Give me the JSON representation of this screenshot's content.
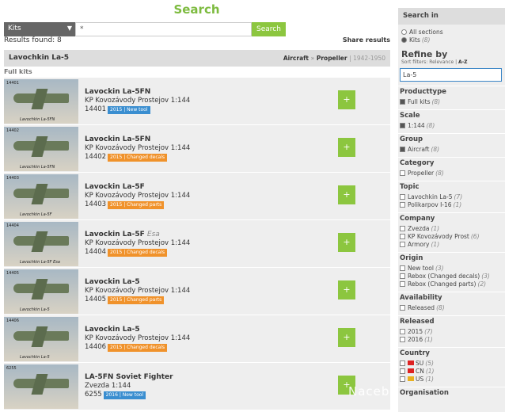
{
  "title": "Search",
  "search": {
    "category": "Kits",
    "query": "*",
    "button": "Search"
  },
  "results_found": "Results found: 8",
  "share": "Share results",
  "header": {
    "name": "Lavochkin La-5",
    "crumb1": "Aircraft",
    "sep": "»",
    "crumb2": "Propeller",
    "years": "| 1942-1950"
  },
  "section_label": "Full kits",
  "items": [
    {
      "name": "Lavockin La-5FN",
      "suffix": "",
      "maker": "KP Kovozávody Prostejov 1:144",
      "code": "14401",
      "badge": "2015 | New tool",
      "badge_color": "#3a8ed0",
      "caption": "Lavochkin La-5FN"
    },
    {
      "name": "Lavockin La-5FN",
      "suffix": "",
      "maker": "KP Kovozávody Prostejov 1:144",
      "code": "14402",
      "badge": "2015 | Changed decals",
      "badge_color": "#f0922b",
      "caption": "Lavochkin La-5FN"
    },
    {
      "name": "Lavockin La-5F",
      "suffix": "",
      "maker": "KP Kovozávody Prostejov 1:144",
      "code": "14403",
      "badge": "2015 | Changed parts",
      "badge_color": "#f0922b",
      "caption": "Lavochkin La-5F"
    },
    {
      "name": "Lavockin La-5F",
      "suffix": "Esa",
      "maker": "KP Kovozávody Prostejov 1:144",
      "code": "14404",
      "badge": "2015 | Changed decals",
      "badge_color": "#f0922b",
      "caption": "Lavochkin La-5F Esa"
    },
    {
      "name": "Lavockin La-5",
      "suffix": "",
      "maker": "KP Kovozávody Prostejov 1:144",
      "code": "14405",
      "badge": "2015 | Changed parts",
      "badge_color": "#f0922b",
      "caption": "Lavochkin La-5"
    },
    {
      "name": "Lavockin La-5",
      "suffix": "",
      "maker": "KP Kovozávody Prostejov 1:144",
      "code": "14406",
      "badge": "2015 | Changed decals",
      "badge_color": "#f0922b",
      "caption": "Lavochkin La-5"
    },
    {
      "name": "LA-5FN Soviet Fighter",
      "suffix": "",
      "maker": "Zvezda 1:144",
      "code": "6255",
      "badge": "2016 | New tool",
      "badge_color": "#3a8ed0",
      "caption": ""
    }
  ],
  "plus": "+",
  "sidebar": {
    "search_in": "Search in",
    "all_sections": "All sections",
    "kits": "Kits",
    "kits_count": "(8)",
    "refine": "Refine by",
    "sort_prefix": "Sort filters: Relevance |",
    "sort_az": "A-Z",
    "refine_value": "La-5",
    "groups": [
      {
        "title": "Producttype",
        "opts": [
          {
            "l": "Full kits",
            "c": "(8)",
            "on": true
          }
        ]
      },
      {
        "title": "Scale",
        "opts": [
          {
            "l": "1:144",
            "c": "(8)",
            "on": true
          }
        ]
      },
      {
        "title": "Group",
        "opts": [
          {
            "l": "Aircraft",
            "c": "(8)",
            "on": true
          }
        ]
      },
      {
        "title": "Category",
        "opts": [
          {
            "l": "Propeller",
            "c": "(8)",
            "on": false
          }
        ]
      },
      {
        "title": "Topic",
        "opts": [
          {
            "l": "Lavochkin La-5",
            "c": "(7)",
            "on": false
          },
          {
            "l": "Polikarpov I-16",
            "c": "(1)",
            "on": false
          }
        ]
      },
      {
        "title": "Company",
        "opts": [
          {
            "l": "Zvezda",
            "c": "(1)",
            "on": false
          },
          {
            "l": "KP Kovozávody Prost",
            "c": "(6)",
            "on": false
          },
          {
            "l": "Armory",
            "c": "(1)",
            "on": false
          }
        ]
      },
      {
        "title": "Origin",
        "opts": [
          {
            "l": "New tool",
            "c": "(3)",
            "on": false
          },
          {
            "l": "Rebox (Changed decals)",
            "c": "(3)",
            "on": false
          },
          {
            "l": "Rebox (Changed parts)",
            "c": "(2)",
            "on": false
          }
        ]
      },
      {
        "title": "Availability",
        "opts": [
          {
            "l": "Released",
            "c": "(8)",
            "on": false
          }
        ]
      },
      {
        "title": "Released",
        "opts": [
          {
            "l": "2015",
            "c": "(7)",
            "on": false
          },
          {
            "l": "2016",
            "c": "(1)",
            "on": false
          }
        ]
      },
      {
        "title": "Country",
        "opts": [
          {
            "l": "SU",
            "c": "(5)",
            "on": false,
            "flag": "#d22"
          },
          {
            "l": "CN",
            "c": "(1)",
            "on": false,
            "flag": "#d22"
          },
          {
            "l": "US",
            "c": "(1)",
            "on": false,
            "flag": "#e8b020"
          }
        ]
      }
    ],
    "organisation": "Organisation"
  },
  "watermark": "Nacebook"
}
